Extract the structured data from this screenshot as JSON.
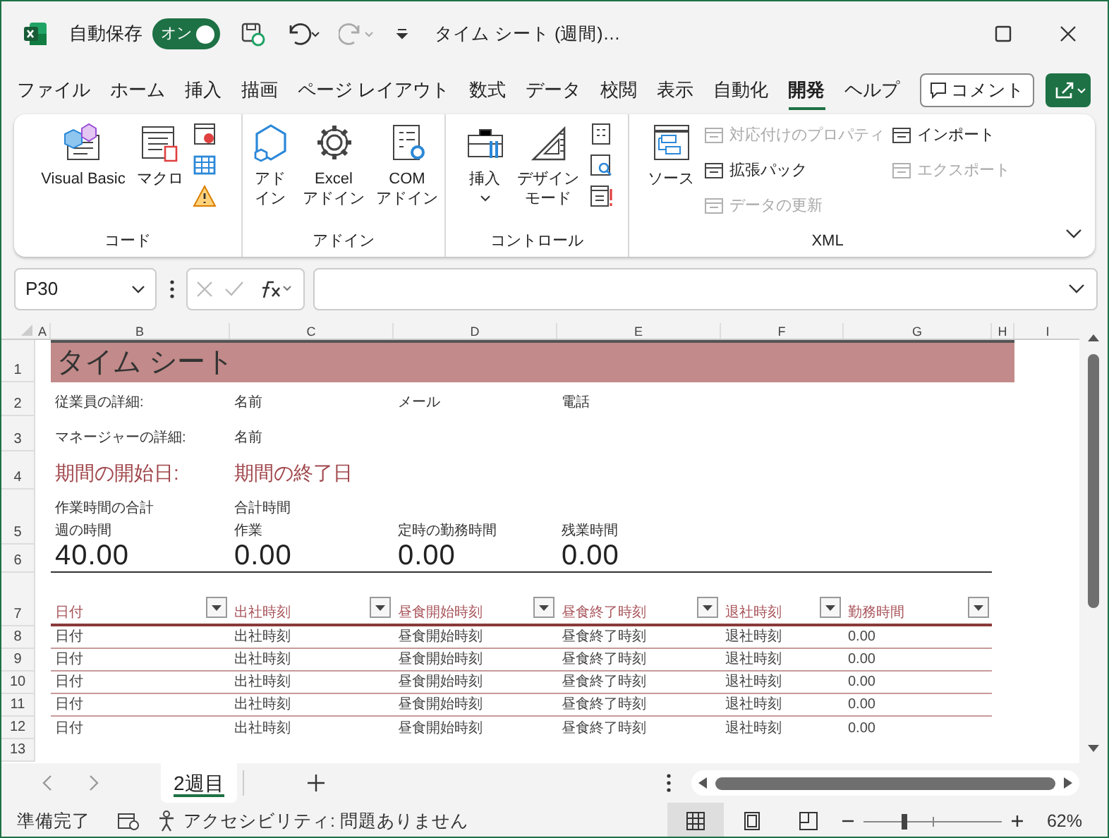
{
  "title_bar": {
    "autosave_label": "自動保存",
    "autosave": {
      "label": "オン",
      "on": true
    },
    "title": "タイム シート (週間)…"
  },
  "menu_tabs": [
    {
      "label": "ファイル",
      "selected": false
    },
    {
      "label": "ホーム",
      "selected": false
    },
    {
      "label": "挿入",
      "selected": false
    },
    {
      "label": "描画",
      "selected": false
    },
    {
      "label": "ページ レイアウト",
      "selected": false
    },
    {
      "label": "数式",
      "selected": false
    },
    {
      "label": "データ",
      "selected": false
    },
    {
      "label": "校閲",
      "selected": false
    },
    {
      "label": "表示",
      "selected": false
    },
    {
      "label": "自動化",
      "selected": false
    },
    {
      "label": "開発",
      "selected": true
    },
    {
      "label": "ヘルプ",
      "selected": false
    }
  ],
  "comment_button": "コメント",
  "ribbon": [
    {
      "label": "コード",
      "items": [
        {
          "kind": "large",
          "lines": [
            "Visual Basic"
          ]
        },
        {
          "kind": "large",
          "lines": [
            "マクロ"
          ]
        },
        {
          "kind": "icon_column"
        }
      ]
    },
    {
      "label": "アドイン",
      "items": [
        {
          "kind": "large",
          "lines": [
            "アド",
            "イン"
          ]
        },
        {
          "kind": "large",
          "lines": [
            "Excel",
            "アドイン"
          ]
        },
        {
          "kind": "large",
          "lines": [
            "COM",
            "アドイン"
          ]
        }
      ]
    },
    {
      "label": "コントロール",
      "items": [
        {
          "kind": "large",
          "lines": [
            "挿入"
          ],
          "dropdown": true
        },
        {
          "kind": "large",
          "lines": [
            "デザイン",
            "モード"
          ]
        },
        {
          "kind": "icon_column"
        }
      ]
    },
    {
      "label": "XML",
      "items": [
        {
          "kind": "large",
          "lines": [
            "ソース"
          ]
        },
        {
          "kind": "stack",
          "entries": [
            {
              "label": "対応付けのプロパティ",
              "disabled": true
            },
            {
              "label": "拡張パック",
              "disabled": false
            },
            {
              "label": "データの更新",
              "disabled": true
            }
          ]
        },
        {
          "kind": "stack",
          "entries": [
            {
              "label": "インポート",
              "disabled": false
            },
            {
              "label": "エクスポート",
              "disabled": true
            }
          ]
        }
      ]
    }
  ],
  "formula_bar": {
    "name_box": "P30"
  },
  "sheet": {
    "columns": [
      "A",
      "B",
      "C",
      "D",
      "E",
      "F",
      "G",
      "H",
      "I"
    ],
    "rows": [
      {
        "number": "1",
        "kind": "title",
        "cells": [
          "",
          "タイム シート"
        ]
      },
      {
        "number": "2",
        "kind": "details",
        "cells": [
          "",
          "従業員の詳細:",
          "名前",
          "メール",
          "電話"
        ]
      },
      {
        "number": "3",
        "kind": "details",
        "cells": [
          "",
          "マネージャーの詳細:",
          "名前"
        ]
      },
      {
        "number": "4",
        "kind": "dates",
        "cells": [
          "",
          "期間の開始日:",
          "期間の終了日"
        ]
      },
      {
        "number": "5",
        "kind": "captions",
        "notes_from_b": [
          "作業時間の合計",
          "合計時間"
        ],
        "cells": [
          "",
          "週の時間",
          "作業",
          "定時の勤務時間",
          "残業時間"
        ]
      },
      {
        "number": "6",
        "kind": "totals",
        "cells": [
          "",
          "40.00",
          "0.00",
          "0.00",
          "0.00"
        ]
      },
      {
        "number": "7",
        "kind": "table_header",
        "cells": [
          "",
          "日付",
          "出社時刻",
          "昼食開始時刻",
          "昼食終了時刻",
          "退社時刻",
          "勤務時間"
        ]
      },
      {
        "number": "8",
        "kind": "table_row",
        "cells": [
          "",
          "日付",
          "出社時刻",
          "昼食開始時刻",
          "昼食終了時刻",
          "退社時刻",
          "0.00"
        ]
      },
      {
        "number": "9",
        "kind": "table_row",
        "cells": [
          "",
          "日付",
          "出社時刻",
          "昼食開始時刻",
          "昼食終了時刻",
          "退社時刻",
          "0.00"
        ]
      },
      {
        "number": "10",
        "kind": "table_row",
        "cells": [
          "",
          "日付",
          "出社時刻",
          "昼食開始時刻",
          "昼食終了時刻",
          "退社時刻",
          "0.00"
        ]
      },
      {
        "number": "11",
        "kind": "table_row",
        "cells": [
          "",
          "日付",
          "出社時刻",
          "昼食開始時刻",
          "昼食終了時刻",
          "退社時刻",
          "0.00"
        ]
      },
      {
        "number": "12",
        "kind": "table_row",
        "cells": [
          "",
          "日付",
          "出社時刻",
          "昼食開始時刻",
          "昼食終了時刻",
          "退社時刻",
          "0.00"
        ]
      },
      {
        "number": "13",
        "kind": "empty",
        "cells": []
      }
    ]
  },
  "sheet_tabs": [
    {
      "label": "2週目",
      "selected": true
    }
  ],
  "status_bar": {
    "ready": "準備完了",
    "accessibility": "アクセシビリティ: 問題ありません",
    "view_buttons": [
      {
        "selected": true
      },
      {
        "selected": false
      },
      {
        "selected": false
      }
    ],
    "zoom": {
      "level": 0.3,
      "reading": "62%"
    }
  }
}
